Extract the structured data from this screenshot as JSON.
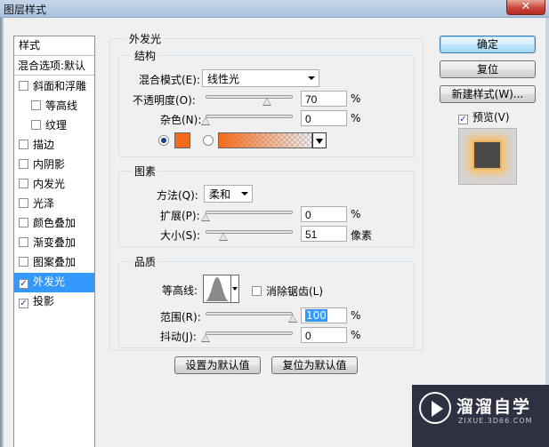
{
  "window": {
    "title": "图层样式",
    "close_glyph": "✕"
  },
  "sidebar": {
    "header": "样式",
    "blend_options": "混合选项:默认",
    "items": [
      {
        "label": "斜面和浮雕",
        "checked": false,
        "sub": false
      },
      {
        "label": "等高线",
        "checked": false,
        "sub": true
      },
      {
        "label": "纹理",
        "checked": false,
        "sub": true
      },
      {
        "label": "描边",
        "checked": false,
        "sub": false
      },
      {
        "label": "内阴影",
        "checked": false,
        "sub": false
      },
      {
        "label": "内发光",
        "checked": false,
        "sub": false
      },
      {
        "label": "光泽",
        "checked": false,
        "sub": false
      },
      {
        "label": "颜色叠加",
        "checked": false,
        "sub": false
      },
      {
        "label": "渐变叠加",
        "checked": false,
        "sub": false
      },
      {
        "label": "图案叠加",
        "checked": false,
        "sub": false
      },
      {
        "label": "外发光",
        "checked": true,
        "sub": false,
        "selected": true
      },
      {
        "label": "投影",
        "checked": true,
        "sub": false
      }
    ],
    "check_glyph": "✓"
  },
  "outer_glow": {
    "title": "外发光",
    "structure": {
      "title": "结构",
      "blend_mode_label": "混合模式(E):",
      "blend_mode_value": "线性光",
      "opacity_label": "不透明度(O):",
      "opacity_value": "70",
      "opacity_level": 0.7,
      "noise_label": "杂色(N):",
      "noise_value": "0",
      "noise_level": 0,
      "percent": "%",
      "color": "#f26b1d",
      "gradient_from": "#f26b1d"
    },
    "elements": {
      "title": "图素",
      "method_label": "方法(Q):",
      "method_value": "柔和",
      "spread_label": "扩展(P):",
      "spread_value": "0",
      "spread_level": 0,
      "size_label": "大小(S):",
      "size_value": "51",
      "size_unit": "像素",
      "size_level": 0.2,
      "percent": "%"
    },
    "quality": {
      "title": "品质",
      "contour_label": "等高线:",
      "antialias_label": "消除锯齿(L)",
      "antialias_checked": false,
      "range_label": "范围(R):",
      "range_value": "100",
      "range_level": 1.0,
      "jitter_label": "抖动(J):",
      "jitter_value": "0",
      "jitter_level": 0,
      "percent": "%"
    },
    "make_default": "设置为默认值",
    "reset_default": "复位为默认值"
  },
  "actions": {
    "ok": "确定",
    "reset": "复位",
    "new_style": "新建样式(W)...",
    "preview_label": "预览(V)",
    "preview_checked": true
  },
  "watermark": {
    "text": "溜溜自学",
    "sub": "ZIXUE.3D66.COM"
  }
}
